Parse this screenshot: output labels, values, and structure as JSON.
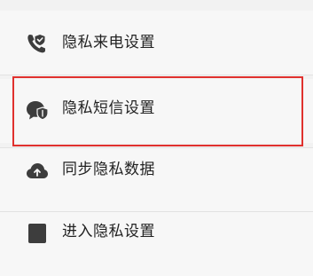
{
  "menu": {
    "items": [
      {
        "label": "隐私来电设置",
        "icon": "phone-shield-icon"
      },
      {
        "label": "隐私短信设置",
        "icon": "message-shield-icon"
      },
      {
        "label": "同步隐私数据",
        "icon": "cloud-upload-icon"
      },
      {
        "label": "进入隐私设置",
        "icon": "settings-icon"
      }
    ],
    "highlight_color": "#e0312e",
    "icon_color": "#3d3d3d"
  }
}
